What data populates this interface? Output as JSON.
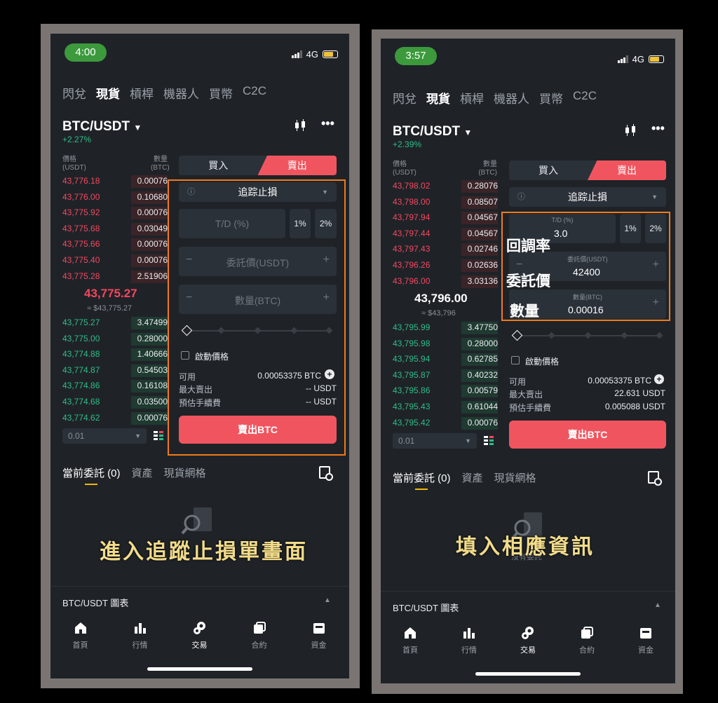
{
  "left": {
    "status_time": "4:00",
    "network": "4G",
    "top_tabs": [
      "閃兌",
      "現貨",
      "槓桿",
      "機器人",
      "買幣",
      "C2C"
    ],
    "pair": "BTC/USDT",
    "change": "+2.27%",
    "col_price": "價格",
    "col_price_unit": "(USDT)",
    "col_qty": "數量",
    "col_qty_unit": "(BTC)",
    "asks": [
      {
        "p": "43,776.18",
        "q": "0.00076"
      },
      {
        "p": "43,776.00",
        "q": "0.10680"
      },
      {
        "p": "43,775.92",
        "q": "0.00076"
      },
      {
        "p": "43,775.68",
        "q": "0.03049"
      },
      {
        "p": "43,775.66",
        "q": "0.00076"
      },
      {
        "p": "43,775.40",
        "q": "0.00076"
      },
      {
        "p": "43,775.28",
        "q": "2.51906"
      }
    ],
    "mid_price": "43,775.27",
    "mid_sub": "≈ $43,775.27",
    "bids": [
      {
        "p": "43,775.27",
        "q": "3.47499"
      },
      {
        "p": "43,775.00",
        "q": "0.28000"
      },
      {
        "p": "43,774.88",
        "q": "1.40666"
      },
      {
        "p": "43,774.87",
        "q": "0.54503"
      },
      {
        "p": "43,774.86",
        "q": "0.16108"
      },
      {
        "p": "43,774.68",
        "q": "0.03500"
      },
      {
        "p": "43,774.62",
        "q": "0.00076"
      }
    ],
    "depth": "0.01",
    "buy": "買入",
    "sell": "賣出",
    "order_type": "追踪止損",
    "td_placeholder": "T/D (%)",
    "pct1": "1%",
    "pct2": "2%",
    "price_placeholder": "委託價(USDT)",
    "qty_placeholder": "數量(BTC)",
    "trigger_label": "啟動價格",
    "avail_label": "可用",
    "avail_value": "0.00053375 BTC",
    "max_sell_label": "最大賣出",
    "max_sell_value": "-- USDT",
    "fee_label": "預估手續費",
    "fee_value": "-- USDT",
    "sell_button": "賣出BTC",
    "order_tabs": [
      "當前委託 (0)",
      "資產",
      "現貨網格"
    ],
    "caption": "進入追蹤止損單畫面",
    "chart_bar": "BTC/USDT 圖表",
    "nav": [
      "首頁",
      "行情",
      "交易",
      "合約",
      "資金"
    ]
  },
  "right": {
    "status_time": "3:57",
    "network": "4G",
    "top_tabs": [
      "閃兌",
      "現貨",
      "槓桿",
      "機器人",
      "買幣",
      "C2C"
    ],
    "pair": "BTC/USDT",
    "change": "+2.39%",
    "col_price": "價格",
    "col_price_unit": "(USDT)",
    "col_qty": "數量",
    "col_qty_unit": "(BTC)",
    "asks": [
      {
        "p": "43,798.02",
        "q": "0.28076"
      },
      {
        "p": "43,798.00",
        "q": "0.08507"
      },
      {
        "p": "43,797.94",
        "q": "0.04567"
      },
      {
        "p": "43,797.44",
        "q": "0.04567"
      },
      {
        "p": "43,797.43",
        "q": "0.02746"
      },
      {
        "p": "43,796.26",
        "q": "0.02636"
      },
      {
        "p": "43,796.00",
        "q": "3.03136"
      }
    ],
    "mid_price": "43,796.00",
    "mid_sub": "≈ $43,796",
    "bids": [
      {
        "p": "43,795.99",
        "q": "3.47750"
      },
      {
        "p": "43,795.98",
        "q": "0.28000"
      },
      {
        "p": "43,795.94",
        "q": "0.62785"
      },
      {
        "p": "43,795.87",
        "q": "0.40232"
      },
      {
        "p": "43,795.86",
        "q": "0.00579"
      },
      {
        "p": "43,795.43",
        "q": "0.61044"
      },
      {
        "p": "43,795.42",
        "q": "0.00076"
      }
    ],
    "depth": "0.01",
    "buy": "買入",
    "sell": "賣出",
    "order_type": "追踪止損",
    "td_label": "T/D (%)",
    "td_value": "3.0",
    "pct1": "1%",
    "pct2": "2%",
    "price_label": "委託價(USDT)",
    "price_value": "42400",
    "qty_label": "數量(BTC)",
    "qty_value": "0.00016",
    "ann_td": "回調率",
    "ann_price": "委託價",
    "ann_qty": "數量",
    "trigger_label": "啟動價格",
    "avail_label": "可用",
    "avail_value": "0.00053375 BTC",
    "max_sell_label": "最大賣出",
    "max_sell_value": "22.631 USDT",
    "fee_label": "預估手續費",
    "fee_value": "0.005088 USDT",
    "sell_button": "賣出BTC",
    "order_tabs": [
      "當前委託 (0)",
      "資產",
      "現貨網格"
    ],
    "caption": "填入相應資訊",
    "empty_text": "沒有委託",
    "chart_bar": "BTC/USDT 圖表",
    "nav": [
      "首頁",
      "行情",
      "交易",
      "合約",
      "資金"
    ]
  }
}
